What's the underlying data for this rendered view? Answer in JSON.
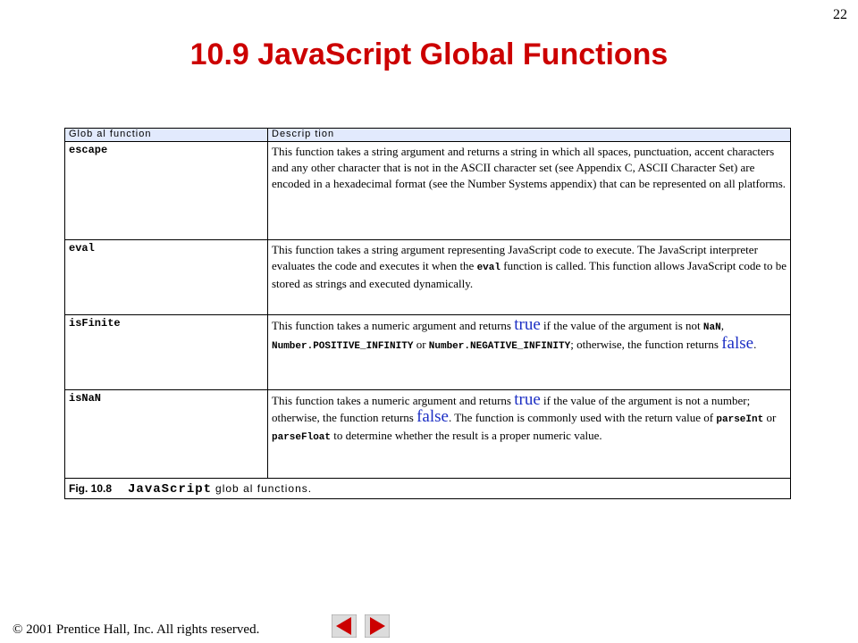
{
  "slide": {
    "page_number": "22",
    "title": "10.9  JavaScript Global Functions"
  },
  "table": {
    "headers": [
      "Glob al function",
      "Descrip tion"
    ],
    "rows": [
      {
        "name": "escape",
        "desc": [
          "This function takes a string argument and returns a string in which all spaces, punctuation, accent characters and any other character that is not in the ASCII character set (see Appendix C, ASCII Character Set) are encoded in a hexadecimal format (see the Number Systems appendix) that can be represented on all platforms."
        ]
      },
      {
        "name": "eval",
        "desc": [
          "This function takes a string argument representing JavaScript code to execute. The JavaScript interpreter evaluates the code and executes it when the ",
          "eval",
          " function is called. This function allows JavaScript code to be stored as strings and executed dynamically."
        ]
      },
      {
        "name": "isFinite",
        "desc": [
          "This function takes a numeric argument and returns ",
          "true",
          " if the value of the argument is not ",
          "NaN",
          ", ",
          "Number.POSITIVE_INFINITY",
          " or ",
          "Number.NEGATIVE_INFINITY",
          "; otherwise, the function returns ",
          "false",
          "."
        ]
      },
      {
        "name": "isNaN",
        "desc": [
          "This function takes a numeric argument and returns ",
          "true",
          " if the value of the argument is not a number; otherwise, the function returns ",
          "false",
          ". The function is commonly used with the return value of ",
          "parseInt",
          " or ",
          "parseFloat",
          " to determine whether the result is a proper numeric value."
        ]
      }
    ],
    "caption": {
      "label": "Fig. 10.8",
      "code": "JavaScript",
      "text": "glob al functions."
    }
  },
  "footer": {
    "copyright": "© 2001 Prentice Hall, Inc.  All rights reserved.",
    "prev_icon": "left-arrow",
    "next_icon": "right-arrow",
    "nav_color": "#cc0000",
    "nav_bg": "#dcdcdc"
  },
  "colors": {
    "title": "#cc0000",
    "header_bg": "#e2eafd",
    "literal_blue": "#1c2fc4"
  }
}
